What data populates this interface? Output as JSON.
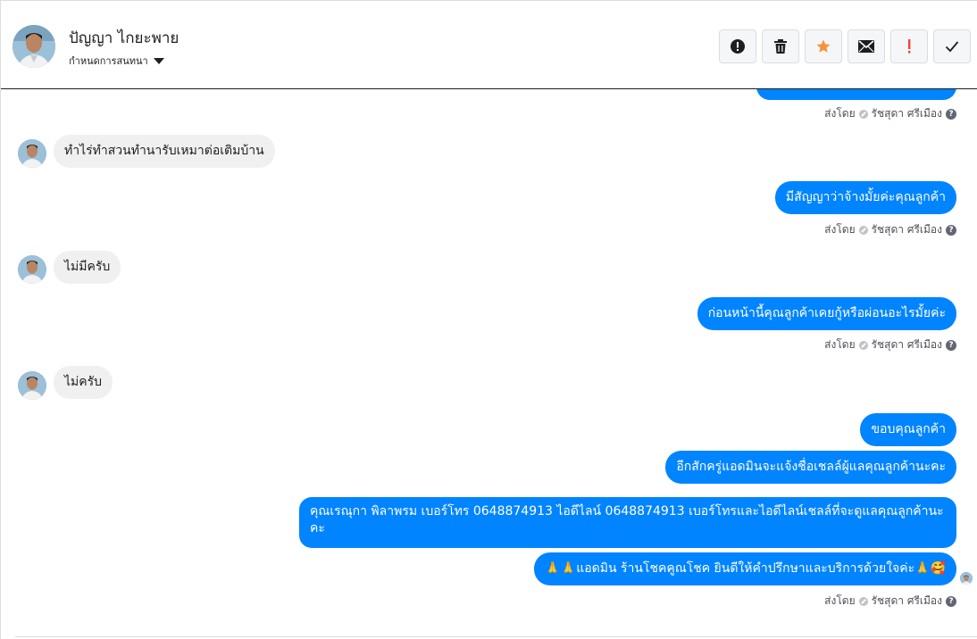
{
  "header": {
    "contact_name": "ปัญญา ไกยะพาย",
    "assign_label": "กำหนดการสนทนา"
  },
  "toolbar": {
    "buttons": [
      {
        "icon": "alert-circle-icon"
      },
      {
        "icon": "trash-icon"
      },
      {
        "icon": "star-icon",
        "color": "#f7923a"
      },
      {
        "icon": "envelope-icon"
      },
      {
        "icon": "exclamation-icon",
        "color": "#fa3e3e"
      },
      {
        "icon": "check-icon"
      }
    ]
  },
  "sent_by": {
    "prefix": "ส่งโดย",
    "agent": "รัชสุดา ศรีเมือง",
    "help": "?"
  },
  "messages": [
    {
      "dir": "in",
      "text": "ทำไร่ทำสวนทำนารับเหมาต่อเติมบ้าน"
    },
    {
      "dir": "out",
      "text": "มีสัญญาว่าจ้างมั้ยค่ะคุณลูกค้า"
    },
    {
      "dir": "in",
      "text": "ไม่มีครับ"
    },
    {
      "dir": "out",
      "text": "ก่อนหน้านี้คุณลูกค้าเคยกู้หรือผ่อนอะไรมั้ยค่ะ"
    },
    {
      "dir": "in",
      "text": "ไม่ครับ"
    },
    {
      "dir": "out",
      "text": "ขอบคุณลูกค้า"
    },
    {
      "dir": "out",
      "text": "อีกสักครู่แอดมินจะแจ้งชื่อเชลล์ผู้แลคุณลูกค้านะคะ"
    },
    {
      "dir": "out",
      "text": "คุณเรณุกา พิลาพรม        เบอร์โทร 0648874913  ไอดีไลน์ 0648874913  เบอร์โทรและไอดีไลน์เชลล์ที่จะดูแลคุณลูกค้านะคะ"
    },
    {
      "dir": "out",
      "text": "🙏🙏แอดมิน ร้านโชคคูณโชค ยินดีให้คำปรึกษาและบริการด้วยใจค่ะ🙏🥰"
    }
  ]
}
